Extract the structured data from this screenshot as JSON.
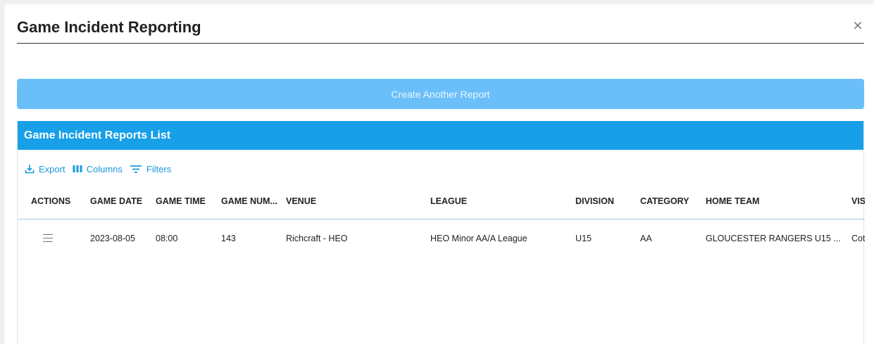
{
  "modal": {
    "title": "Game Incident Reporting",
    "close_label": "×"
  },
  "create_button": "Create Another Report",
  "list": {
    "title": "Game Incident Reports List",
    "toolbar": {
      "export": "Export",
      "columns": "Columns",
      "filters": "Filters"
    },
    "columns": [
      "ACTIONS",
      "GAME DATE",
      "GAME TIME",
      "GAME NUM...",
      "VENUE",
      "LEAGUE",
      "DIVISION",
      "CATEGORY",
      "HOME TEAM",
      "VIS"
    ],
    "rows": [
      {
        "game_date": "2023-08-05",
        "game_time": "08:00",
        "game_num": "143",
        "venue": "Richcraft - HEO",
        "league": "HEO Minor AA/A League",
        "division": "U15",
        "category": "AA",
        "home_team": "GLOUCESTER RANGERS U15 ...",
        "visitor": "Cot"
      }
    ]
  },
  "colors": {
    "accent": "#17a0e8",
    "create_button": "#6abff9",
    "link": "#1a98dd"
  }
}
